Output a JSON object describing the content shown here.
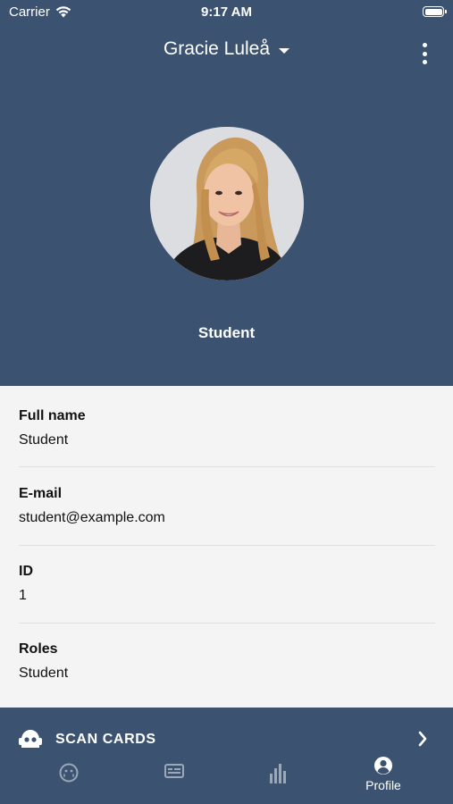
{
  "status_bar": {
    "carrier": "Carrier",
    "time": "9:17 AM"
  },
  "header": {
    "account_name": "Gracie Luleå"
  },
  "profile": {
    "display_name": "Student",
    "fields": [
      {
        "label": "Full name",
        "value": "Student"
      },
      {
        "label": "E-mail",
        "value": "student@example.com"
      },
      {
        "label": "ID",
        "value": "1"
      },
      {
        "label": "Roles",
        "value": "Student"
      }
    ]
  },
  "scan_cards": {
    "label": "SCAN CARDS"
  },
  "tab_bar": {
    "tabs": [
      {
        "icon": "scan-circle-icon",
        "label": ""
      },
      {
        "icon": "card-icon",
        "label": ""
      },
      {
        "icon": "bar-chart-icon",
        "label": ""
      },
      {
        "icon": "user-circle-icon",
        "label": "Profile",
        "active": true
      }
    ]
  },
  "colors": {
    "primary": "#3b5370",
    "panel": "#f4f4f4",
    "inactive_tab": "#9aa8b8"
  }
}
